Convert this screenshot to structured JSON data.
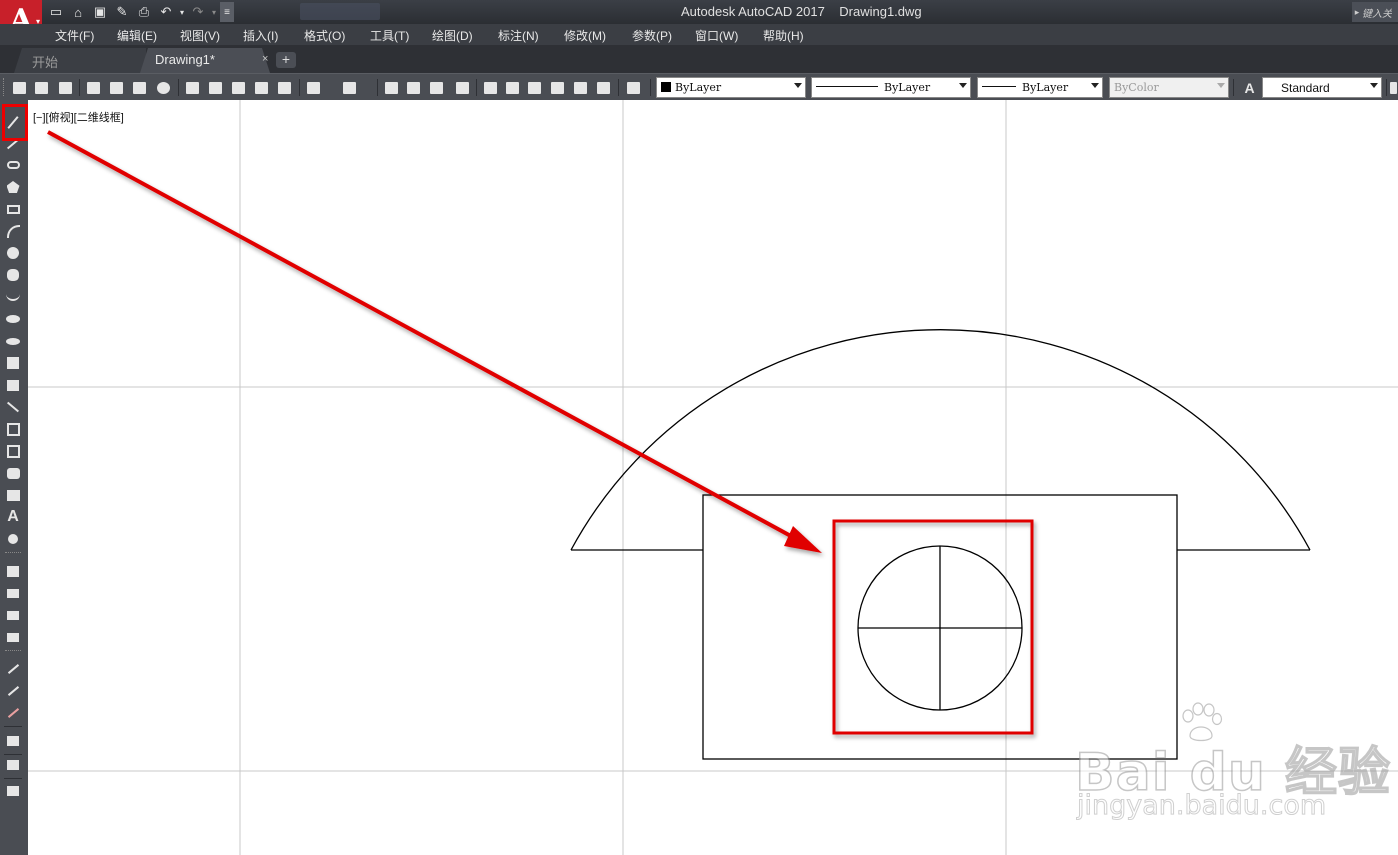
{
  "titlebar": {
    "title": "Autodesk AutoCAD 2017    Drawing1.dwg",
    "search_placeholder": "键入关",
    "quick_access": [
      "new-icon",
      "open-icon",
      "save-icon",
      "saveas-icon",
      "plot-icon",
      "undo-icon",
      "redo-icon",
      "customize-icon"
    ]
  },
  "menu": {
    "items": [
      "文件(F)",
      "编辑(E)",
      "视图(V)",
      "插入(I)",
      "格式(O)",
      "工具(T)",
      "绘图(D)",
      "标注(N)",
      "修改(M)",
      "参数(P)",
      "窗口(W)",
      "帮助(H)"
    ]
  },
  "tabs": {
    "start": "开始",
    "drawing": "Drawing1*",
    "close": "×",
    "new": "+"
  },
  "toolbar": {
    "color_combo": "ByLayer",
    "linetype_combo": "ByLayer",
    "lineweight_combo": "ByLayer",
    "plotstyle_combo": "ByColor",
    "textstyle_combo": "Standard"
  },
  "viewport": {
    "label": "[−][俯视][二维线框]"
  },
  "colors": {
    "highlight": "#e00000",
    "arrow": "#e00000",
    "drawing_line": "#000000",
    "grid": "#c8c8c8"
  },
  "watermark": {
    "brand": "Bai  du 经验",
    "url": "jingyan.baidu.com"
  }
}
